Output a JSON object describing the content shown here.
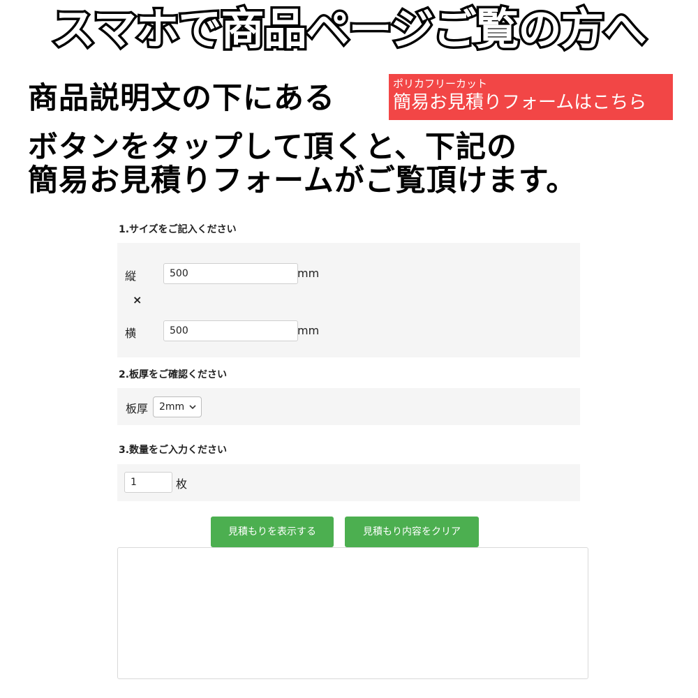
{
  "banner": {
    "headline": "スマホで商品ページご覧の方へ",
    "intro_line1": "商品説明文の下にある",
    "intro_line2": "ボタンをタップして頂くと、下記の",
    "intro_line3": "簡易お見積りフォームがご覧頂けます。"
  },
  "estimate_link": {
    "sub_label": "ポリカフリーカット",
    "main_label": "簡易お見積りフォームはこちら"
  },
  "form": {
    "size_section": {
      "title": "1.サイズをご記入ください",
      "height_label": "縦",
      "height_value": "500",
      "height_unit": "mm",
      "times_symbol": "×",
      "width_label": "横",
      "width_value": "500",
      "width_unit": "mm"
    },
    "thickness_section": {
      "title": "2.板厚をご確認ください",
      "label": "板厚",
      "selected": "2mm"
    },
    "quantity_section": {
      "title": "3.数量をご入力ください",
      "value": "1",
      "unit": "枚"
    },
    "show_estimate_label": "見積もりを表示する",
    "clear_label": "見積もり内容をクリア"
  },
  "colors": {
    "accent_red": "#f24646",
    "button_green": "#4caf50",
    "panel_bg": "#f5f5f5"
  }
}
